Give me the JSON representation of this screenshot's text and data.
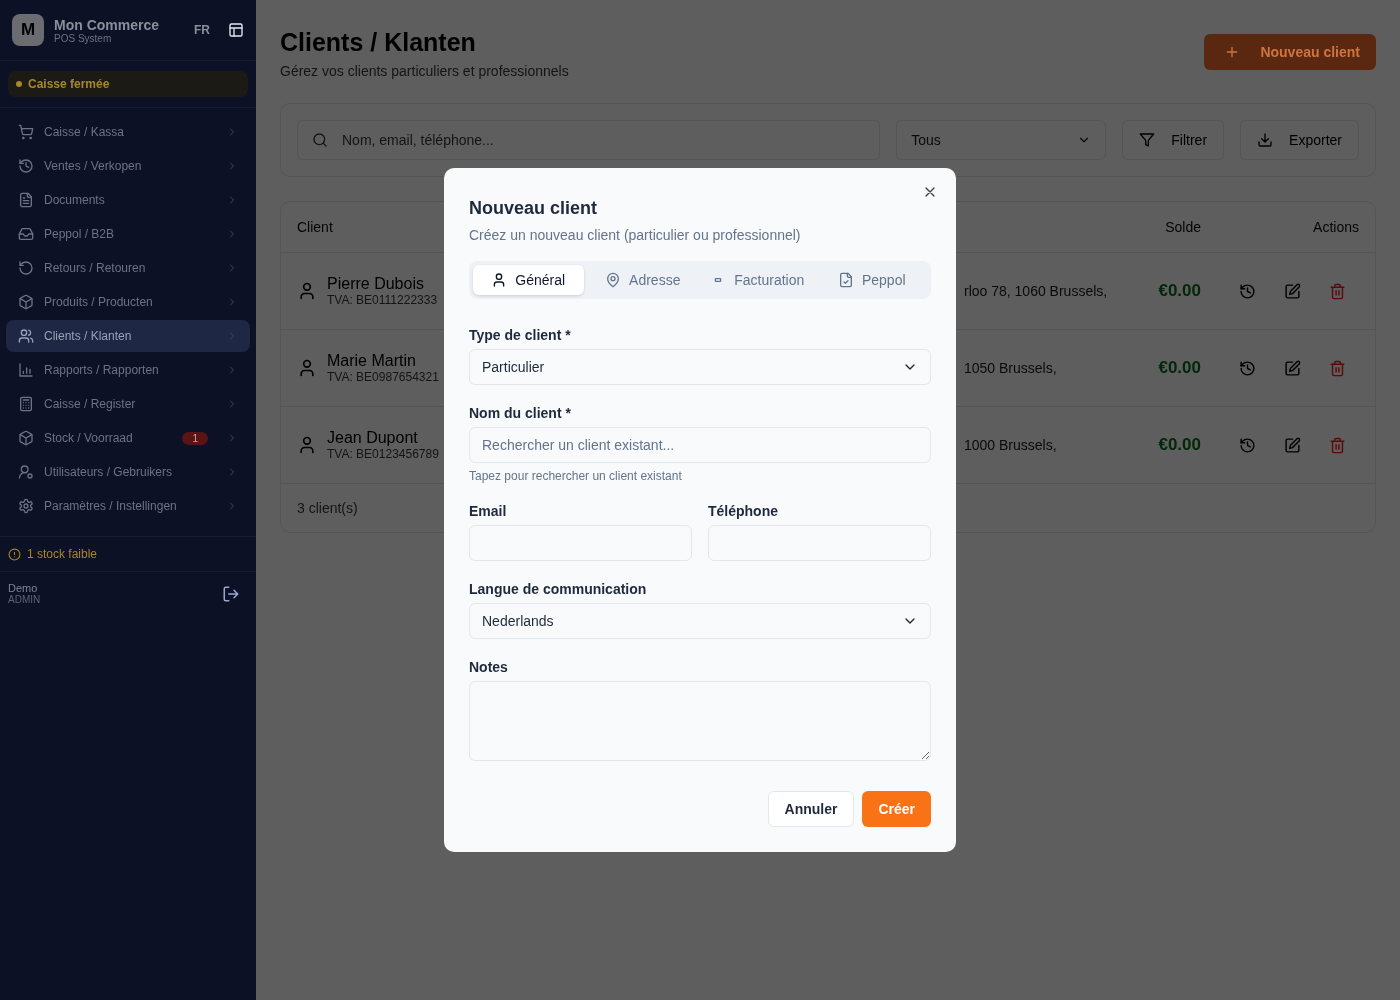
{
  "sidebar": {
    "brand": {
      "initial": "M",
      "name": "Mon Commerce",
      "subtitle": "POS System"
    },
    "language": "FR",
    "register_status": "Caisse fermée",
    "items": [
      {
        "label": "Caisse / Kassa",
        "selected": false
      },
      {
        "label": "Ventes / Verkopen",
        "selected": false
      },
      {
        "label": "Documents",
        "selected": false
      },
      {
        "label": "Peppol / B2B",
        "selected": false
      },
      {
        "label": "Retours / Retouren",
        "selected": false
      },
      {
        "label": "Produits / Producten",
        "selected": false
      },
      {
        "label": "Clients / Klanten",
        "selected": true
      },
      {
        "label": "Rapports / Rapporten",
        "selected": false
      },
      {
        "label": "Caisse / Register",
        "selected": false
      },
      {
        "label": "Stock / Voorraad",
        "selected": false,
        "badge": "1"
      },
      {
        "label": "Utilisateurs / Gebruikers",
        "selected": false
      },
      {
        "label": "Paramètres / Instellingen",
        "selected": false
      }
    ],
    "alert": "1 stock faible",
    "user": {
      "name": "Demo",
      "role": "ADMIN"
    }
  },
  "page": {
    "title": "Clients / Klanten",
    "subtitle": "Gérez vos clients particuliers et professionnels",
    "new_button": "Nouveau client"
  },
  "filters": {
    "search": {
      "placeholder": "Nom, email, téléphone..."
    },
    "type_select": "Tous",
    "buttons": [
      "Filtrer",
      "Exporter"
    ]
  },
  "table": {
    "columns": [
      "Client",
      "Solde",
      "Actions"
    ],
    "rows": [
      {
        "name": "Pierre Dubois",
        "vat": "TVA: BE0111222333",
        "address": "rloo 78, 1060 Brussels,",
        "balance": "€0.00"
      },
      {
        "name": "Marie Martin",
        "vat": "TVA: BE0987654321",
        "address": "1050 Brussels,",
        "balance": "€0.00"
      },
      {
        "name": "Jean Dupont",
        "vat": "TVA: BE0123456789",
        "address": "1000 Brussels,",
        "balance": "€0.00"
      }
    ],
    "footer": "3 client(s)"
  },
  "modal": {
    "title": "Nouveau client",
    "description": "Créez un nouveau client (particulier ou professionnel)",
    "tabs": [
      {
        "label": "Général",
        "selected": true
      },
      {
        "label": "Adresse",
        "selected": false
      },
      {
        "label": "Facturation",
        "selected": false
      },
      {
        "label": "Peppol",
        "selected": false
      }
    ],
    "fields": [
      {
        "kind": "select",
        "label": "Type de client *",
        "value": "Particulier"
      },
      {
        "kind": "input",
        "label": "Nom du client *",
        "placeholder": "Rechercher un client existant...",
        "help": "Tapez pour rechercher un client existant"
      },
      {
        "kind": "pair",
        "fields": [
          {
            "kind": "input",
            "label": "Email"
          },
          {
            "kind": "input",
            "label": "Téléphone"
          }
        ]
      },
      {
        "kind": "select",
        "label": "Langue de communication",
        "value": "Nederlands"
      },
      {
        "kind": "textarea",
        "label": "Notes"
      }
    ],
    "buttons": [
      {
        "label": "Annuler",
        "kind": "secondary"
      },
      {
        "label": "Créer",
        "kind": "primary"
      }
    ]
  }
}
